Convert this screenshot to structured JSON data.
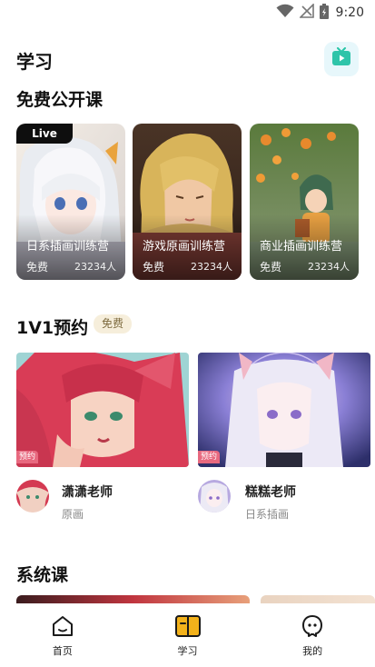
{
  "status_bar": {
    "time": "9:20"
  },
  "header": {
    "title": "学习"
  },
  "free_section": {
    "title": "免费公开课",
    "live_label": "Live",
    "cards": [
      {
        "name": "日系插画训练营",
        "price": "免费",
        "count": "23234人"
      },
      {
        "name": "游戏原画训练营",
        "price": "免费",
        "count": "23234人"
      },
      {
        "name": "商业插画训练营",
        "price": "免费",
        "count": "23234人"
      }
    ]
  },
  "one_on_one": {
    "title": "1V1预约",
    "tag": "免费",
    "badge": "预约",
    "teachers": [
      {
        "name": "潇潇老师",
        "subtitle": "原画"
      },
      {
        "name": "糕糕老师",
        "subtitle": "日系插画"
      }
    ]
  },
  "system_section": {
    "title": "系统课"
  },
  "bottom_nav": {
    "items": [
      {
        "label": "首页",
        "icon": "home-icon"
      },
      {
        "label": "学习",
        "icon": "learn-icon"
      },
      {
        "label": "我的",
        "icon": "profile-icon"
      }
    ],
    "active_color": "#f3b21b"
  }
}
